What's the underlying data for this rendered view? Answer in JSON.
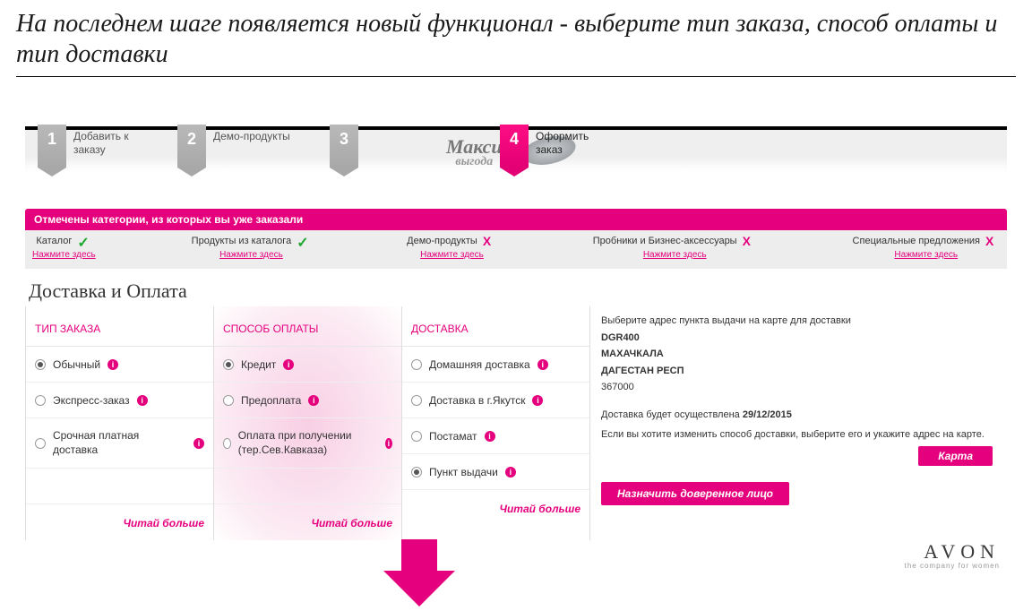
{
  "slide_title": "На последнем шаге появляется новый функционал -  выберите тип заказа, способ оплаты и тип доставки",
  "steps": [
    {
      "num": "1",
      "label": "Добавить к\nзаказу"
    },
    {
      "num": "2",
      "label": "Демо-продукты"
    },
    {
      "num": "3",
      "label": ""
    },
    {
      "num": "4",
      "label": "Оформить\nзаказ"
    }
  ],
  "maxi": {
    "big": "Макси",
    "sub": "выгода"
  },
  "catbar_header": "Отмечены категории, из которых вы уже заказали",
  "categories": [
    {
      "label": "Каталог",
      "mark": "check",
      "link": "Нажмите здесь"
    },
    {
      "label": "Продукты из каталога",
      "mark": "check",
      "link": "Нажмите здесь"
    },
    {
      "label": "Демо-продукты",
      "mark": "cross",
      "link": "Нажмите здесь"
    },
    {
      "label": "Пробники и Бизнес-аксессуары",
      "mark": "cross",
      "link": "Нажмите здесь"
    },
    {
      "label": "Специальные предложения",
      "mark": "cross",
      "link": "Нажмите здесь"
    }
  ],
  "section_title": "Доставка и Оплата",
  "headers": {
    "c1": "ТИП ЗАКАЗА",
    "c2": "СПОСОБ ОПЛАТЫ",
    "c3": "ДОСТАВКА"
  },
  "order_types": [
    {
      "label": "Обычный",
      "sel": true
    },
    {
      "label": "Экспресс-заказ",
      "sel": false
    },
    {
      "label": "Срочная платная доставка",
      "sel": false
    }
  ],
  "pay_types": [
    {
      "label": "Кредит",
      "sel": true
    },
    {
      "label": "Предоплата",
      "sel": false
    },
    {
      "label": "Оплата при получении (тер.Сев.Кавказа)",
      "sel": false
    }
  ],
  "delivery": [
    {
      "label": "Домашняя доставка",
      "sel": false
    },
    {
      "label": "Доставка в г.Якутск",
      "sel": false
    },
    {
      "label": "Постамат",
      "sel": false
    },
    {
      "label": "Пункт выдачи",
      "sel": true
    }
  ],
  "read_more": "Читай больше",
  "side": {
    "intro": "Выберите адрес пункта выдачи на карте для доставки",
    "code": "DGR400",
    "city": "МАХАЧКАЛА",
    "region": "ДАГЕСТАН РЕСП",
    "zip": "367000",
    "date_line_pre": "Доставка будет осуществлена ",
    "date": "29/12/2015",
    "hint": "Если вы хотите изменить способ доставки, выберите его и укажите адрес на карте."
  },
  "buttons": {
    "map": "Карта",
    "trusted": "Назначить доверенное лицо"
  },
  "logo": {
    "brand": "AVON",
    "tag": "the company for women"
  }
}
